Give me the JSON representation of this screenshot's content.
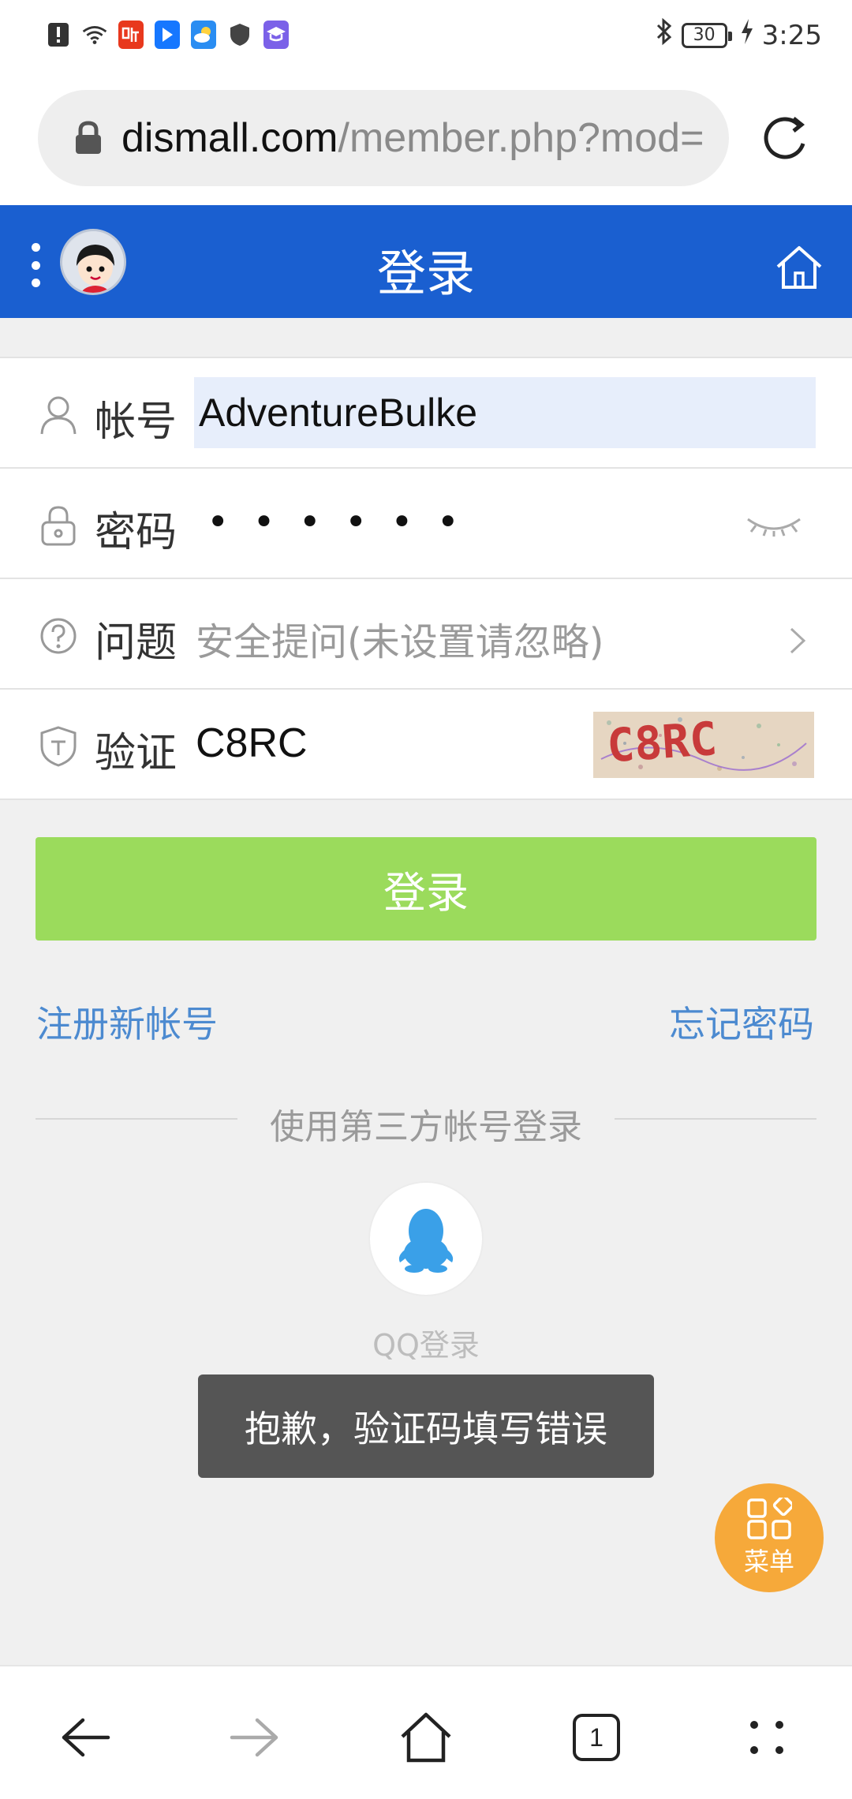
{
  "status_bar": {
    "time": "3:25",
    "battery": "30",
    "left_icons": [
      "alert-icon",
      "wifi-icon",
      "ting-app-icon",
      "direct-app-icon",
      "weather-app-icon",
      "shield-app-icon",
      "edu-app-icon"
    ],
    "right_icons": [
      "bluetooth-icon",
      "battery-icon",
      "charging-icon"
    ]
  },
  "browser": {
    "url_host": "dismall.com",
    "url_path": "/member.php?mod=logging&action=login"
  },
  "header": {
    "title": "登录"
  },
  "form": {
    "account_label": "帐号",
    "account_value": "AdventureBulke",
    "password_label": "密码",
    "password_mask": "••••••",
    "question_label": "问题",
    "question_placeholder": "安全提问(未设置请忽略)",
    "captcha_label": "验证",
    "captcha_value": "C8RC",
    "captcha_image_text": "C8RC"
  },
  "login_button": "登录",
  "links": {
    "register": "注册新帐号",
    "forgot": "忘记密码"
  },
  "third_party": {
    "divider": "使用第三方帐号登录",
    "qq_label": "QQ登录"
  },
  "toast": "抱歉，验证码填写错误",
  "menu_fab": {
    "label": "菜单"
  },
  "bottom_nav": {
    "tab_count": "1"
  },
  "colors": {
    "header_blue": "#1a5fd0",
    "login_green": "#9bdb5c",
    "link_blue": "#4c8ad0",
    "fab_orange": "#f6a93a",
    "qq_blue": "#3aa0e8"
  }
}
